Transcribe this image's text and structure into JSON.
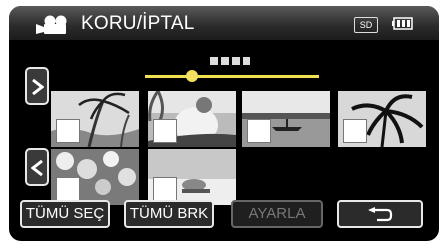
{
  "header": {
    "mode_icon": "video-camera-icon",
    "title": "KORU/İPTAL",
    "media_label": "SD",
    "battery_icon": "battery-icon"
  },
  "navigation": {
    "up_icon": "chevron-right-icon",
    "down_icon": "chevron-left-icon",
    "page_indicator_icon": "page-dots-icon",
    "scroll_position": 0.25
  },
  "thumbnails": [
    {
      "scene": "palm-trees",
      "checked": false
    },
    {
      "scene": "person-palm",
      "checked": false
    },
    {
      "scene": "lake-boat",
      "checked": false
    },
    {
      "scene": "palm-silhouette",
      "checked": false
    },
    {
      "scene": "flowers",
      "checked": false
    },
    {
      "scene": "cat-bed",
      "checked": false
    }
  ],
  "buttons": {
    "select_all": "TÜMÜ SEÇ",
    "clear_all": "TÜMÜ BRK",
    "set": "AYARLA",
    "back_icon": "return-arrow-icon"
  },
  "colors": {
    "accent_yellow": "#f0e050",
    "disabled_text": "#777777",
    "background": "#000000"
  }
}
